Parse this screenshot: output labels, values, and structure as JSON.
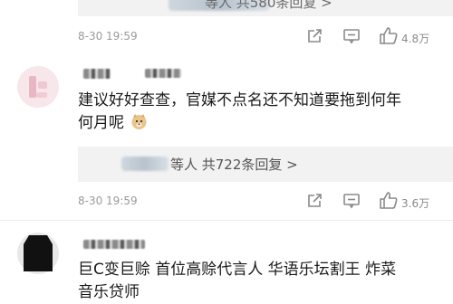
{
  "comments": [
    {
      "reply_text": "等人 共580条回复 >",
      "time": "8-30 19:59",
      "likes": "4.8万"
    },
    {
      "text_line1": "建议好好查查，官媒不点名还不知道要拖到何年",
      "text_line2": "何月呢",
      "reply_text": "等人 共722条回复 >",
      "time": "8-30 19:59",
      "likes": "3.6万"
    },
    {
      "text_line1": "巨C变巨赊 首位高赊代言人 华语乐坛割王 炸菜",
      "text_line2": "音乐贷师"
    }
  ],
  "icons": {
    "share": "share-icon",
    "comment": "comment-icon",
    "like": "thumbs-up-icon",
    "emoji": "doge-emoji"
  }
}
